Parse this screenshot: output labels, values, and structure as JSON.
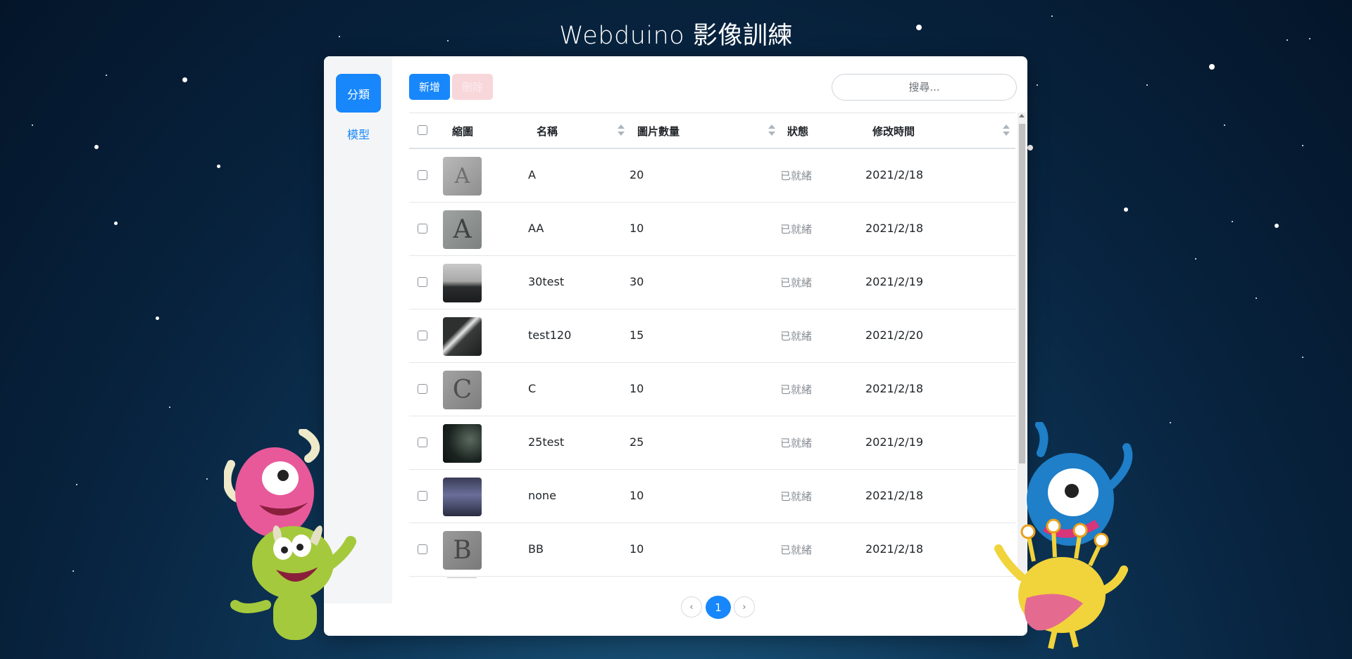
{
  "app": {
    "title": "Webduino 影像訓練"
  },
  "sidebar": {
    "items": [
      {
        "label": "分類",
        "active": true
      },
      {
        "label": "模型",
        "active": false
      }
    ]
  },
  "toolbar": {
    "add_label": "新增",
    "delete_label": "刪除",
    "search_placeholder": "搜尋..."
  },
  "table": {
    "columns": {
      "thumb": "縮圖",
      "name": "名稱",
      "count": "圖片數量",
      "status": "狀態",
      "modified": "修改時間"
    },
    "rows": [
      {
        "thumb_char": "A",
        "name": "A",
        "count": "20",
        "status": "已就緒",
        "modified": "2021/2/18"
      },
      {
        "thumb_char": "A",
        "name": "AA",
        "count": "10",
        "status": "已就緒",
        "modified": "2021/2/18"
      },
      {
        "thumb_char": "",
        "name": "30test",
        "count": "30",
        "status": "已就緒",
        "modified": "2021/2/19"
      },
      {
        "thumb_char": "",
        "name": "test120",
        "count": "15",
        "status": "已就緒",
        "modified": "2021/2/20"
      },
      {
        "thumb_char": "C",
        "name": "C",
        "count": "10",
        "status": "已就緒",
        "modified": "2021/2/18"
      },
      {
        "thumb_char": "",
        "name": "25test",
        "count": "25",
        "status": "已就緒",
        "modified": "2021/2/19"
      },
      {
        "thumb_char": "",
        "name": "none",
        "count": "10",
        "status": "已就緒",
        "modified": "2021/2/18"
      },
      {
        "thumb_char": "B",
        "name": "BB",
        "count": "10",
        "status": "已就緒",
        "modified": "2021/2/18"
      }
    ]
  },
  "pagination": {
    "prev": "‹",
    "current": "1",
    "next": "›"
  },
  "colors": {
    "accent": "#1787fb",
    "danger_light": "#f8d7da"
  }
}
